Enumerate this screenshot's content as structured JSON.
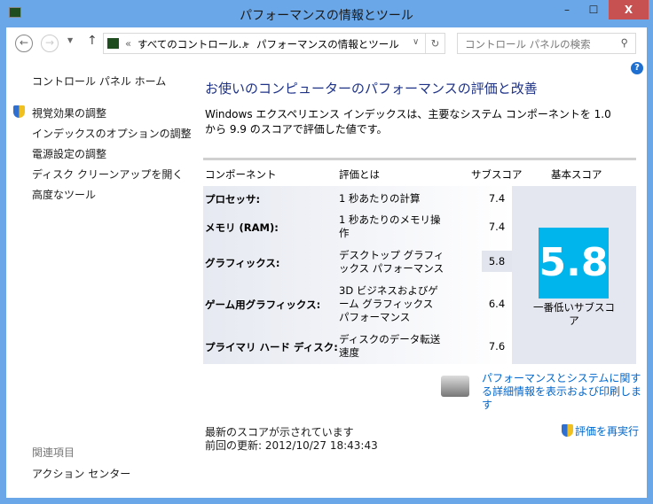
{
  "window": {
    "title": "パフォーマンスの情報とツール",
    "minimize": "–",
    "maximize": "☐",
    "close": "X"
  },
  "address": {
    "prefix": "«",
    "crumb1": "すべてのコントロール...",
    "crumb2": "パフォーマンスの情報とツール"
  },
  "search": {
    "placeholder": "コントロール パネルの検索"
  },
  "sidebar": {
    "home": "コントロール パネル ホーム",
    "items": [
      "視覚効果の調整",
      "インデックスのオプションの調整",
      "電源設定の調整",
      "ディスク クリーンアップを開く",
      "高度なツール"
    ],
    "related_heading": "関連項目",
    "related": [
      "アクション センター"
    ]
  },
  "main": {
    "heading": "お使いのコンピューターのパフォーマンスの評価と改善",
    "description": "Windows エクスペリエンス インデックスは、主要なシステム コンポーネントを 1.0 から 9.9 のスコアで評価した値です。",
    "table": {
      "headers": [
        "コンポーネント",
        "評価とは",
        "サブスコア",
        "基本スコア"
      ],
      "rows": [
        {
          "component": "プロセッサ:",
          "rating": "1 秒あたりの計算",
          "subscore": "7.4"
        },
        {
          "component": "メモリ (RAM):",
          "rating": "1 秒あたりのメモリ操作",
          "subscore": "7.4"
        },
        {
          "component": "グラフィックス:",
          "rating": "デスクトップ グラフィックス パフォーマンス",
          "subscore": "5.8"
        },
        {
          "component": "ゲーム用グラフィックス:",
          "rating": "3D ビジネスおよびゲーム グラフィックス パフォーマンス",
          "subscore": "6.4"
        },
        {
          "component": "プライマリ ハード ディスク:",
          "rating": "ディスクのデータ転送速度",
          "subscore": "7.6"
        }
      ],
      "base_score": "5.8",
      "base_label": "一番低いサブスコア"
    },
    "details_link": "パフォーマンスとシステムに関する詳細情報を表示および印刷します",
    "status": "最新のスコアが示されています",
    "last_update": "前回の更新: 2012/10/27 18:43:43",
    "rerun": "評価を再実行"
  },
  "colors": {
    "titlebar": "#6aa7e8",
    "score": "#00b4ec",
    "link": "#0066cc"
  }
}
